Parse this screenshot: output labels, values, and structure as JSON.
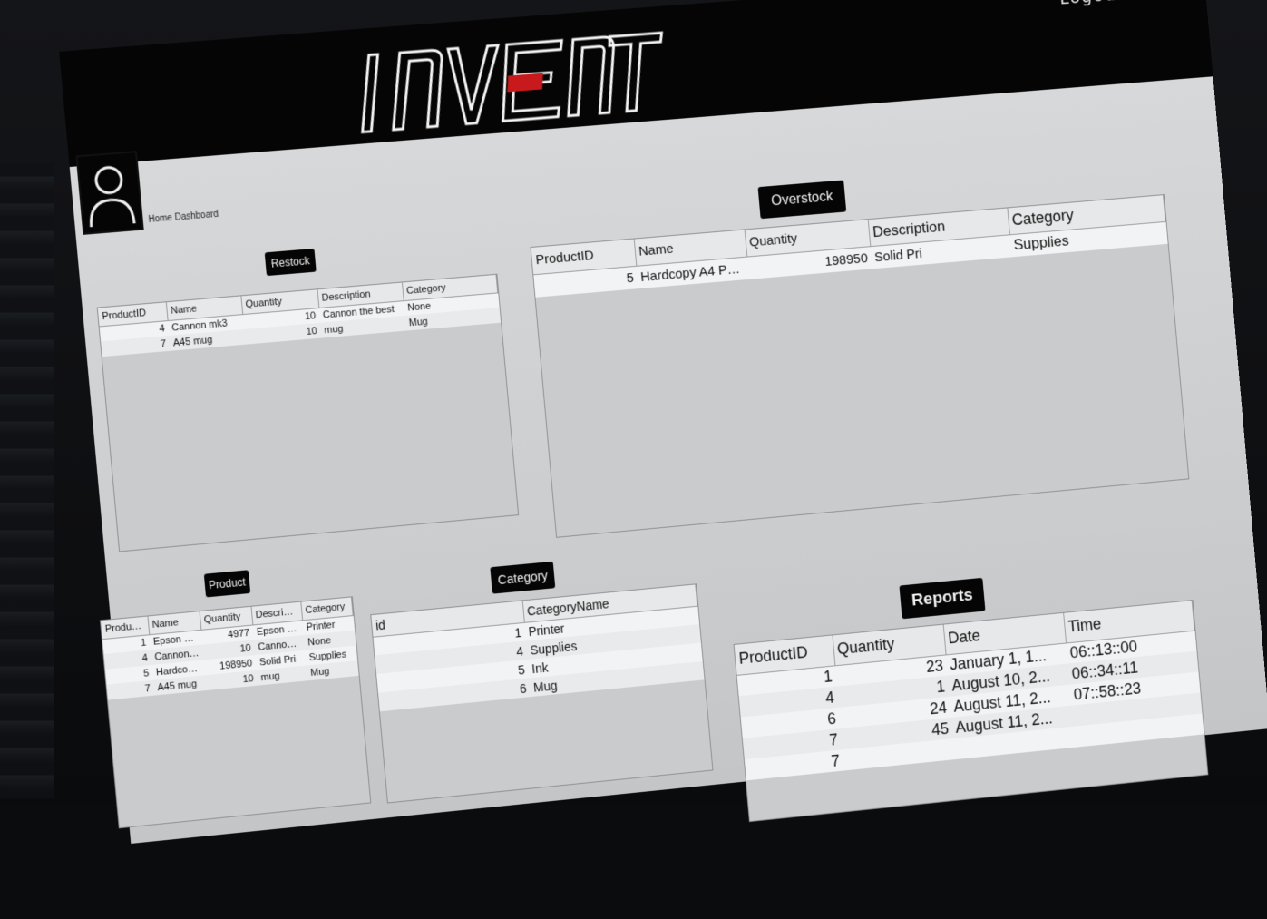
{
  "header": {
    "logo_text": "INVENTO",
    "logout_label": "Logout",
    "breadcrumb": "Home Dashboard"
  },
  "colors": {
    "banner": "#050505",
    "accent": "#c8191c",
    "panel": "#cbcdcf"
  },
  "buttons": {
    "restock": "Restock",
    "overstock": "Overstock",
    "product": "Product",
    "category": "Category",
    "reports": "Reports"
  },
  "restock_table": {
    "columns": [
      "ProductID",
      "Name",
      "Quantity",
      "Description",
      "Category"
    ],
    "rows": [
      [
        "4",
        "Cannon mk3",
        "10",
        "Cannon the best",
        "None"
      ],
      [
        "7",
        "A45 mug",
        "10",
        "mug",
        "Mug"
      ]
    ]
  },
  "overstock_table": {
    "columns": [
      "ProductID",
      "Name",
      "Quantity",
      "Description",
      "Category"
    ],
    "rows": [
      [
        "5",
        "Hardcopy A4 Pa...",
        "198950",
        "Solid Pri",
        "Supplies"
      ]
    ]
  },
  "product_table": {
    "columns": [
      "ProductID",
      "Name",
      "Quantity",
      "Descripti...",
      "Category"
    ],
    "rows": [
      [
        "1",
        "Epson 300",
        "4977",
        "Epson pr...",
        "Printer"
      ],
      [
        "4",
        "Cannon ...",
        "10",
        "Cannon t...",
        "None"
      ],
      [
        "5",
        "Hardcopy...",
        "198950",
        "Solid Pri",
        "Supplies"
      ],
      [
        "7",
        "A45 mug",
        "10",
        "mug",
        "Mug"
      ]
    ]
  },
  "category_table": {
    "columns": [
      "id",
      "CategoryName"
    ],
    "rows": [
      [
        "1",
        "Printer"
      ],
      [
        "4",
        "Supplies"
      ],
      [
        "5",
        "Ink"
      ],
      [
        "6",
        "Mug"
      ]
    ]
  },
  "reports_table": {
    "columns": [
      "ProductID",
      "Quantity",
      "Date",
      "Time"
    ],
    "rows": [
      [
        "1",
        "23",
        "January 1, 1...",
        "06::13::00"
      ],
      [
        "4",
        "1",
        "August 10, 2...",
        "06::34::11"
      ],
      [
        "6",
        "24",
        "August 11, 2...",
        "07::58::23"
      ],
      [
        "7",
        "45",
        "August 11, 2...",
        ""
      ],
      [
        "7",
        "",
        "",
        ""
      ]
    ]
  }
}
